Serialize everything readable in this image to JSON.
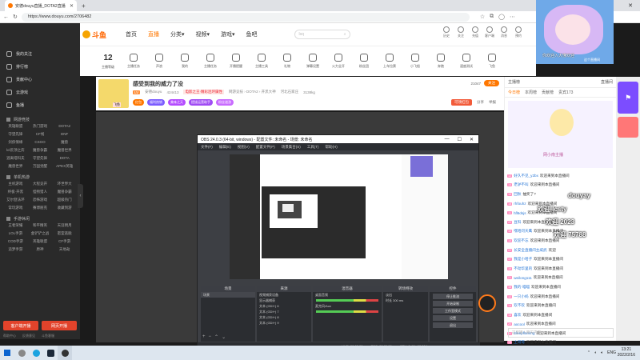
{
  "browser": {
    "tab_title": "安德douyu直播_DOTA2直播",
    "url": "https://www.douyu.com/2706482"
  },
  "header": {
    "logo_text": "斗鱼",
    "nav": [
      "首页",
      "直播",
      "分类",
      "视频",
      "游戏",
      "鱼吧"
    ],
    "search_placeholder": "lsq",
    "icons": [
      "历史",
      "关注",
      "充值",
      "客户端",
      "消息",
      "预约"
    ]
  },
  "toolbar": {
    "level_number": "12",
    "level_label": "主播等级",
    "items": [
      "主播任务",
      "声浪",
      "我的",
      "主播任务",
      "开播提醒",
      "主播工具",
      "礼物",
      "弹幕设置",
      "火力全开",
      "粉丝团",
      "上车拉票",
      "小飞船",
      "奔跑",
      "速度测试",
      "飞鱼"
    ]
  },
  "room": {
    "title": "感受到我的威力了没",
    "avatar_tag": "飞鱼",
    "streamer": "安德douyu",
    "id": "424413",
    "warning": "电影之王·精彩连环属性",
    "category_path": "网游竞技 › DOTA2 › 开黑大神",
    "location": "河北石家庄",
    "fans": "3138kg",
    "tags": [
      "红包",
      "福利热销",
      "美味之天",
      "提拔运营助手",
      "粉丝道游"
    ],
    "viewers": "21047",
    "follow": "关注",
    "promo": "可领红包",
    "share": "分享",
    "report": "举报"
  },
  "right_panel": {
    "head_left": "主播榜",
    "head_right": "直播间",
    "tabs": [
      "今日榜",
      "本周榜",
      "贡献榜",
      "贵宾173"
    ],
    "ad_caption": "网小南主播",
    "chat": [
      {
        "lv": "12",
        "name": "好久不见_y2bx",
        "msg": "欢迎来到本直播间"
      },
      {
        "lv": "14",
        "name": "老驴不叫",
        "msg": "欢迎来到本直播间"
      },
      {
        "lv": "16",
        "name": "回秋",
        "msg": "抽奖了?"
      },
      {
        "lv": "18",
        "name": "rhfouhz",
        "msg": "欢迎来到本直播间"
      },
      {
        "lv": "11",
        "name": "hfl6dsjs",
        "msg": "欢迎来到本直播间"
      },
      {
        "lv": "20",
        "name": "豆科",
        "msg": "欢迎来到本直播间"
      },
      {
        "lv": "15",
        "name": "嘿哈问天鹰",
        "msg": "欢迎来到本直播间"
      },
      {
        "lv": "13",
        "name": "欢迎不忘",
        "msg": "欢迎来到本直播间"
      },
      {
        "lv": "22",
        "name": "长安全直播间主威武",
        "msg": "欢迎"
      },
      {
        "lv": "17",
        "name": "我是小哈子",
        "msg": "欢迎来到本直播间"
      },
      {
        "lv": "19",
        "name": "不动华里的",
        "msg": "欢迎来到本直播间"
      },
      {
        "lv": "21",
        "name": "weilong111",
        "msg": "欢迎来到本直播间"
      },
      {
        "lv": "16",
        "name": "我的·喵喵",
        "msg": "欢迎来到本直播间"
      },
      {
        "lv": "12",
        "name": "一只小蚂",
        "msg": "欢迎来到本直播间"
      },
      {
        "lv": "14",
        "name": "欢不欢",
        "msg": "欢迎来到本直播间"
      },
      {
        "lv": "18",
        "name": "喜欢",
        "msg": "欢迎来到本直播间"
      },
      {
        "lv": "20",
        "name": "aocool",
        "msg": "欢迎来到本直播间"
      },
      {
        "lv": "11",
        "name": "Sleepflaming",
        "msg": "欢迎来到本直播间"
      },
      {
        "lv": "13",
        "name": "土哥哥",
        "msg": "欢迎来到本直播间"
      },
      {
        "lv": "15",
        "name": "zcy9527",
        "msg": "欢迎来到本直播间"
      }
    ],
    "input_placeholder": "这里输入聊天内容"
  },
  "danmu": [
    "douyay",
    "欢迎 lcsty",
    "欢迎 2023",
    "欢迎 75788"
  ],
  "cam": {
    "caption": "你欢迎入大懂欢迎",
    "caption2": "这个直播间"
  },
  "sidebar": {
    "items": [
      "我的关注",
      "排行榜",
      "贡献中心",
      "云游戏",
      "鱼播"
    ],
    "section1": "网游竞技",
    "grid1": [
      "英雄联盟",
      "热门游戏",
      "DOTA2",
      "守望先锋",
      "CF线",
      "DNF",
      "剑侠情缘",
      "CSGO",
      "魔兽",
      "lol云顶之弈",
      "魔兽争霸",
      "魔兽世界",
      "逃离塔科夫",
      "守望先锋",
      "DOTA",
      "魔兽世界",
      "万国觉醒",
      "APEX英雄"
    ],
    "section2": "单机热游",
    "grid2": [
      "主机游戏",
      "大程竞开",
      "环世界大",
      "终极·开黑",
      "怪物猎人",
      "魔兽争霸",
      "艾尔登法环",
      "恐怖游戏",
      "超级热门",
      "常玩游戏",
      "赛博朋克",
      "收藏到游"
    ],
    "section3": "手游休闲",
    "grid3": [
      "王者荣耀",
      "和平精英",
      "天涯明月",
      "LOL手游",
      "金铲铲之战",
      "密室逃脱",
      "COD手游",
      "英雄联盟",
      "CF手游",
      "追梦手游",
      "原神",
      "天地劫"
    ],
    "btn1": "客户端开播",
    "btn2": "网页开播",
    "foot": [
      "帮助中心",
      "反馈意见",
      "斗鱼客服"
    ]
  },
  "obs": {
    "title": "OBS 24.0.3 (64-bit, windows) - 配置文件: 未命名 - 场景: 未命名",
    "menu": [
      "文件(F)",
      "编辑(E)",
      "视图(V)",
      "配置文件(P)",
      "场景集合(S)",
      "工具(T)",
      "帮助(H)"
    ],
    "docks": {
      "scenes": {
        "title": "场景",
        "rows": [
          "场景"
        ]
      },
      "sources": {
        "title": "来源",
        "rows": [
          "视频捕获设备",
          "显示器捕获",
          "文本 (GDI+) 6",
          "文本 (GDI+) 7",
          "文本 (GDI+) 8",
          "文本 (GDI+) 9"
        ]
      },
      "mixer": {
        "title": "混音器",
        "rows": [
          "桌面音频",
          "麦克风/Aux"
        ]
      },
      "transitions": {
        "title": "转场特效",
        "rows": [
          "淡出",
          "时长 300 ms"
        ]
      },
      "controls": {
        "title": "控件",
        "buttons": [
          "停止推流",
          "开始录制",
          "工作室模式",
          "设置",
          "退出"
        ]
      }
    },
    "status": [
      "LIVE: 00:00:00",
      "REC: 00:00:00",
      "CPU: 0.4%, 60.00 fps"
    ]
  },
  "taskbar": {
    "lang": "ENG",
    "time": "13:21",
    "date": "2022/2/16"
  }
}
